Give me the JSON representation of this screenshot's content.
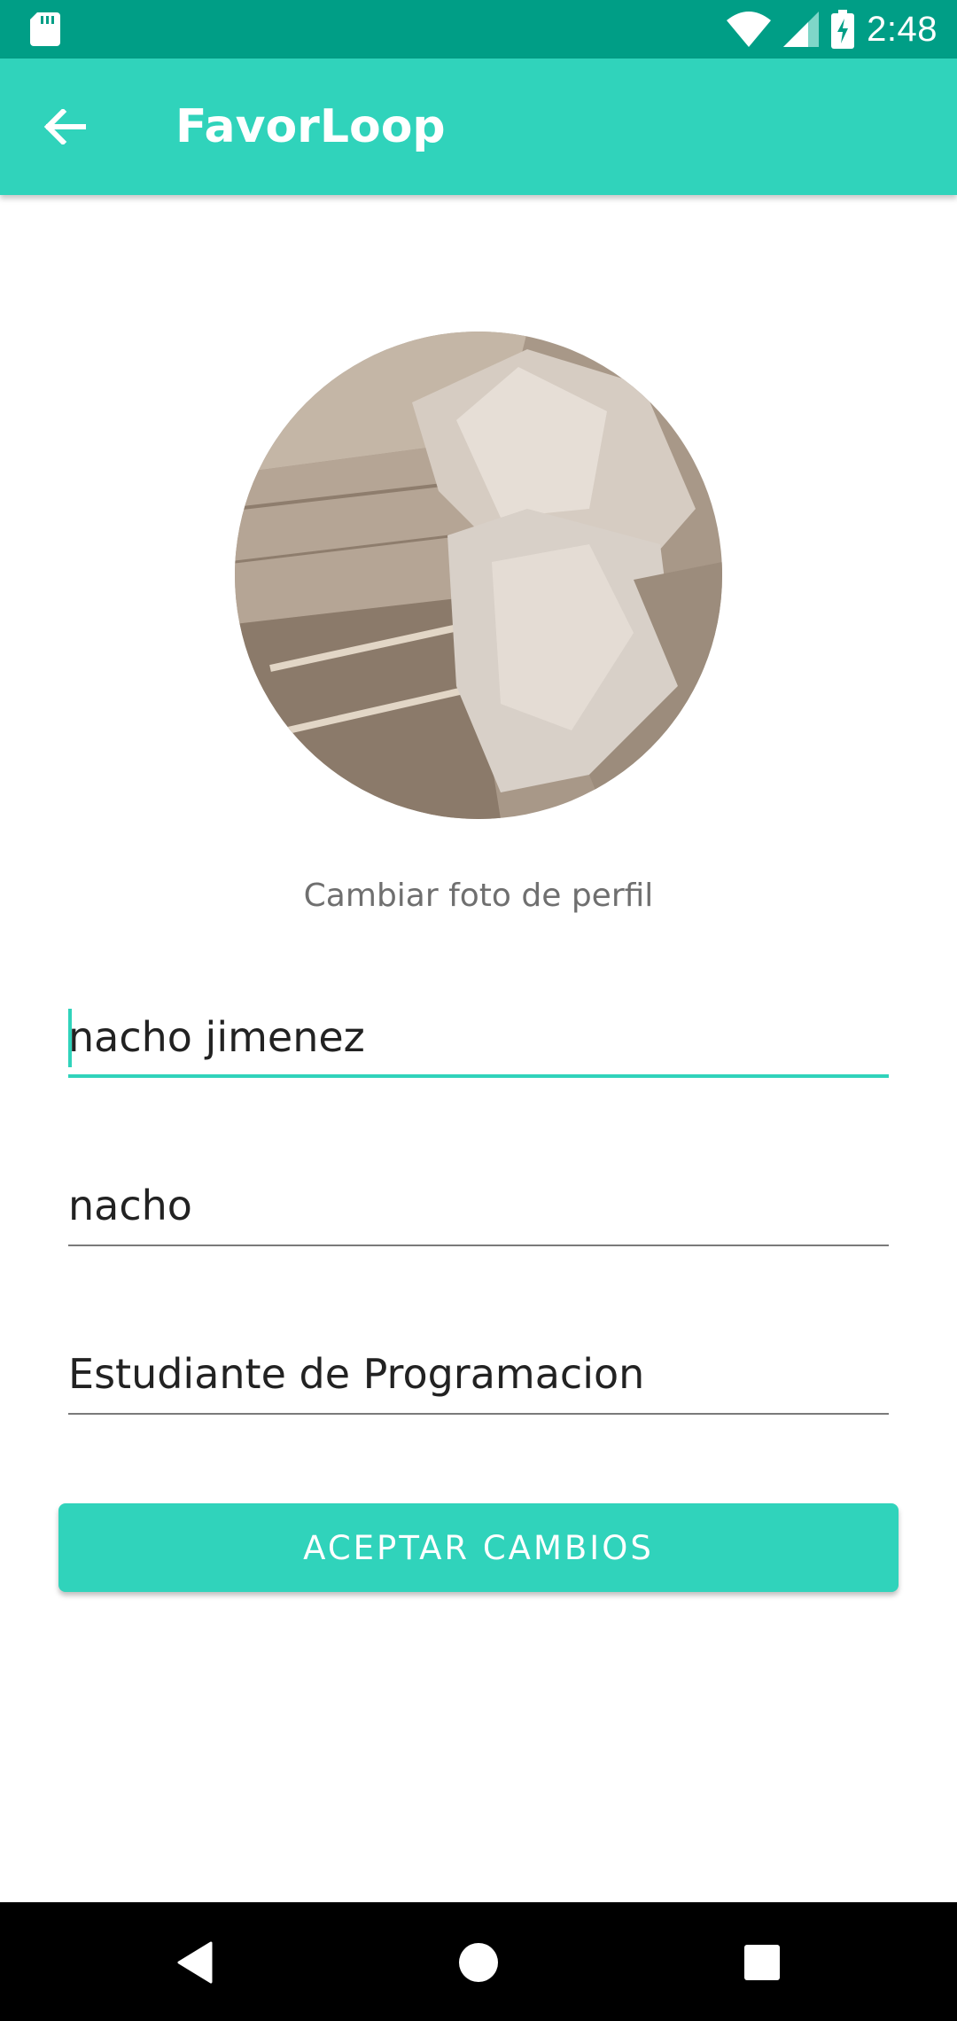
{
  "status_bar": {
    "time": "2:48",
    "icons": [
      "sd-card-icon",
      "wifi-icon",
      "signal-icon",
      "battery-charging-icon"
    ]
  },
  "app_bar": {
    "title": "FavorLoop",
    "back_icon": "arrow-back-icon"
  },
  "profile": {
    "change_photo_label": "Cambiar foto de perfil"
  },
  "form": {
    "name_value": "nacho jimenez",
    "username_value": "nacho",
    "bio_value": "Estudiante de Programacion",
    "submit_label": "ACEPTAR CAMBIOS"
  },
  "nav_bar": {
    "icons": [
      "back-triangle-icon",
      "home-circle-icon",
      "recents-square-icon"
    ]
  },
  "colors": {
    "accent": "#30d3bb",
    "status_bar": "#009e86",
    "nav_bar": "#000000"
  }
}
